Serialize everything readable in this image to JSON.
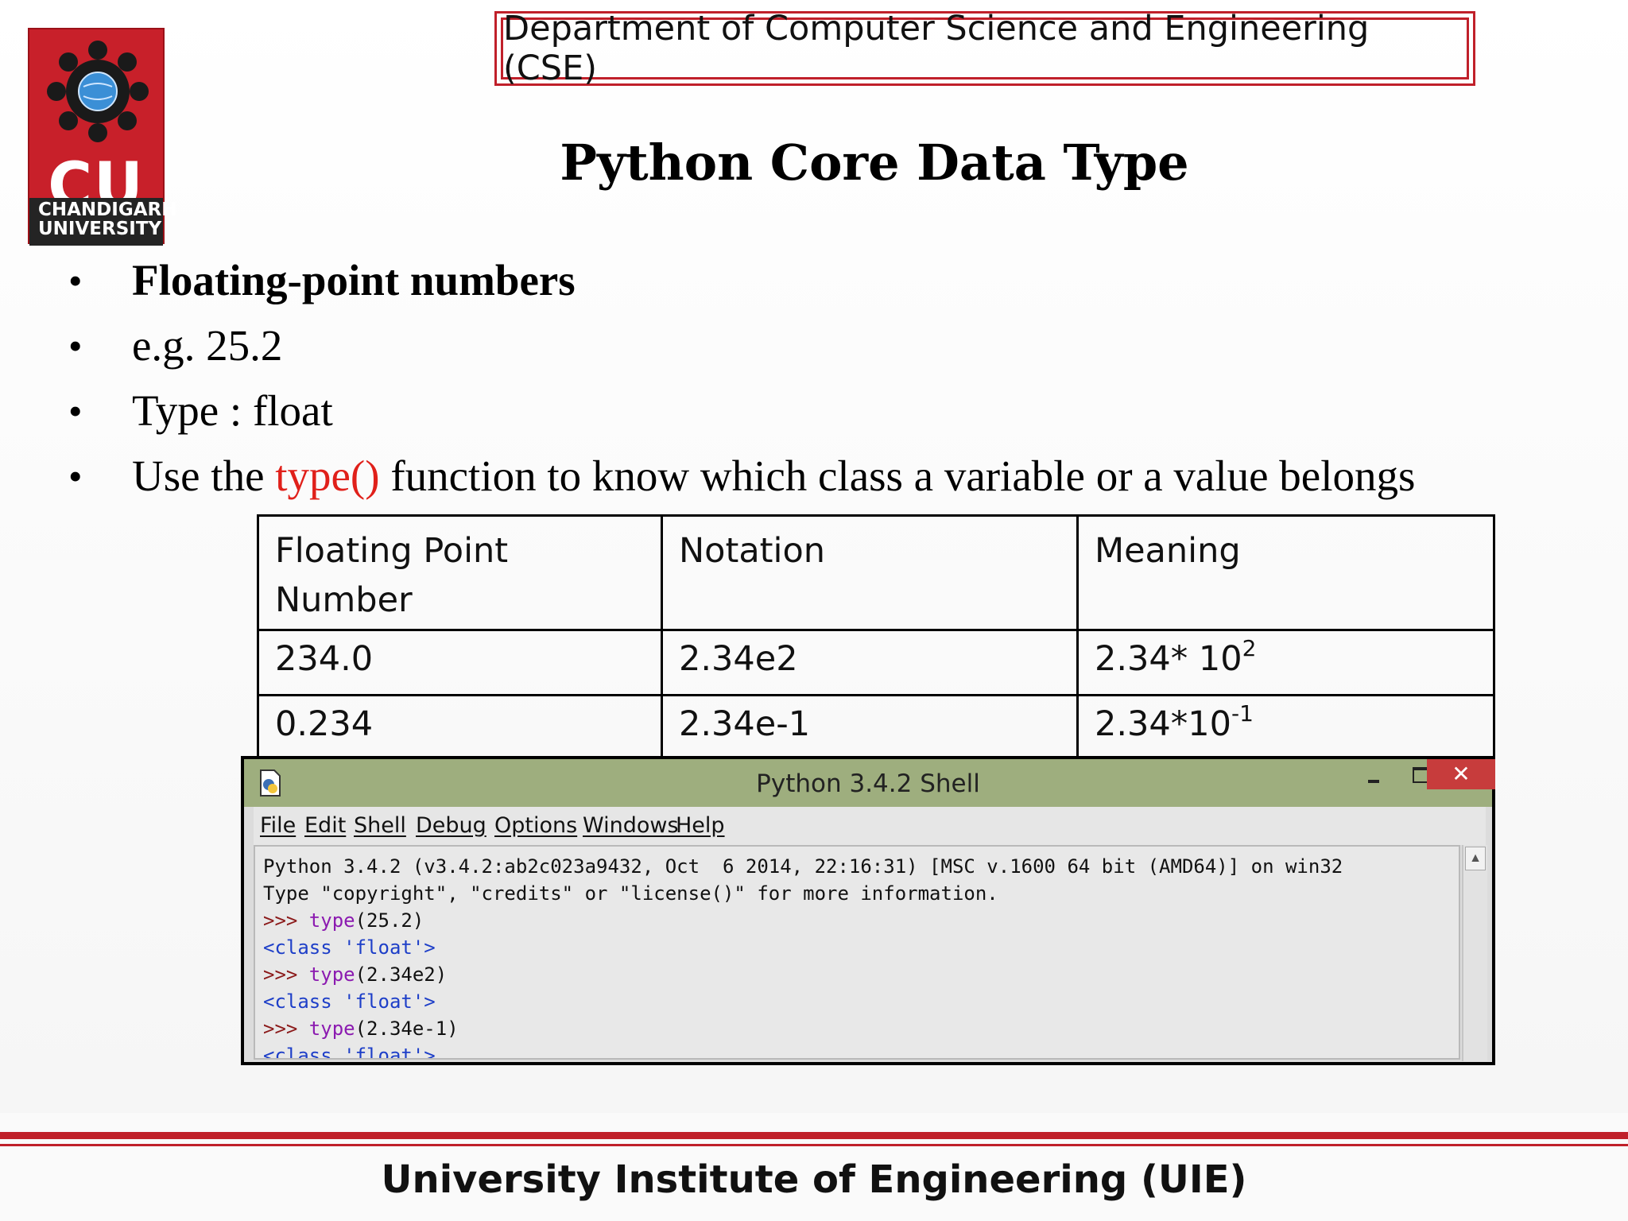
{
  "logo": {
    "text_main": "CU",
    "text_sub": "CHANDIGARH UNIVERSITY",
    "colors": {
      "background": "#c8202a",
      "band": "#242424"
    }
  },
  "header": {
    "department": "Department of Computer Science and Engineering (CSE)"
  },
  "slide": {
    "title": "Python Core Data Type",
    "bullets": [
      {
        "text": "Floating-point numbers"
      },
      {
        "text": "e.g. 25.2"
      },
      {
        "text": "Type : float"
      },
      {
        "pre": "Use the ",
        "highlight": "type()",
        "post": " function to know which class a variable or a value belongs"
      }
    ],
    "bullet_symbol": "•",
    "highlight_color": "#e0201a"
  },
  "table": {
    "headers": [
      "Floating Point Number",
      "Notation",
      "Meaning"
    ],
    "rows": [
      {
        "number": "234.0",
        "notation": "2.34e2",
        "meaning_base": "2.34* 10",
        "meaning_exp": "2"
      },
      {
        "number": "0.234",
        "notation": "2.34e-1",
        "meaning_base": "2.34*10",
        "meaning_exp": "-1"
      }
    ]
  },
  "shell": {
    "title": "Python 3.4.2 Shell",
    "close_label": "✕",
    "menu": [
      "File",
      "Edit",
      "Shell",
      "Debug",
      "Options",
      "Windows",
      "Help"
    ],
    "banner_1": "Python 3.4.2 (v3.4.2:ab2c023a9432, Oct  6 2014, 22:16:31) [MSC v.1600 64 bit (AMD64)] on win32",
    "banner_2": "Type \"copyright\", \"credits\" or \"license()\" for more information.",
    "prompt": ">>> ",
    "session": [
      {
        "func": "type",
        "args": "(25.2)",
        "output": "<class 'float'>"
      },
      {
        "func": "type",
        "args": "(2.34e2)",
        "output": "<class 'float'>"
      },
      {
        "func": "type",
        "args": "(2.34e-1)",
        "output": "<class 'float'>"
      }
    ],
    "colors": {
      "titlebar": "#9eae7e",
      "prompt": "#8b1a1a",
      "keyword": "#8b1ab0",
      "output": "#1e3fc8",
      "close": "#c73c3c"
    }
  },
  "footer": {
    "institute": "University Institute of Engineering (UIE)"
  }
}
